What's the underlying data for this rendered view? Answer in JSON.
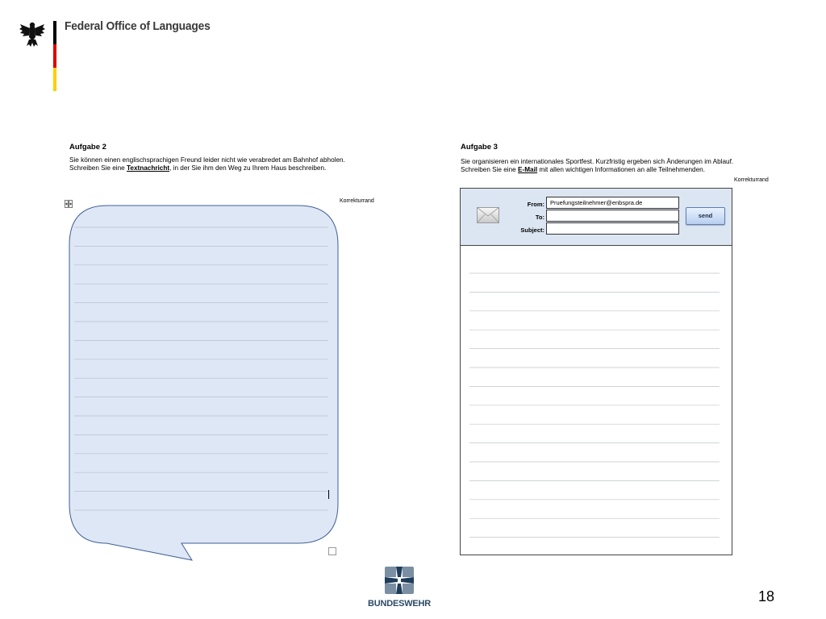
{
  "header": {
    "office_name": "Federal Office of Languages",
    "flag_colors": [
      "#000000",
      "#dd0000",
      "#ffce00"
    ]
  },
  "task2": {
    "title": "Aufgabe 2",
    "text_before": "Sie können einen englischsprachigen Freund leider nicht wie verabredet am Bahnhof abholen. Schreiben Sie eine ",
    "text_emphasis": "Textnachricht",
    "text_after": ", in der Sie ihm den Weg zu Ihrem Haus beschreiben.",
    "margin_label": "Korrekturrand",
    "bubble_fill": "#dee7f5",
    "bubble_stroke": "#3f5f95"
  },
  "task3": {
    "title": "Aufgabe 3",
    "text_before": "Sie organisieren ein internationales Sportfest. Kurzfristig ergeben sich Änderungen im Ablauf. Schreiben Sie eine ",
    "text_emphasis": "E-Mail",
    "text_after": " mit allen wichtigen Informationen an alle Teilnehmenden.",
    "margin_label": "Korrekturrand"
  },
  "email": {
    "from_label": "From:",
    "from_value": "Pruefungsteilnehmer@enbspra.de",
    "to_label": "To:",
    "to_value": "",
    "subject_label": "Subject:",
    "subject_value": "",
    "send_label": "send",
    "header_bg": "#dce6f2"
  },
  "footer": {
    "brand": "BUNDESWEHR",
    "page_number": "18"
  }
}
